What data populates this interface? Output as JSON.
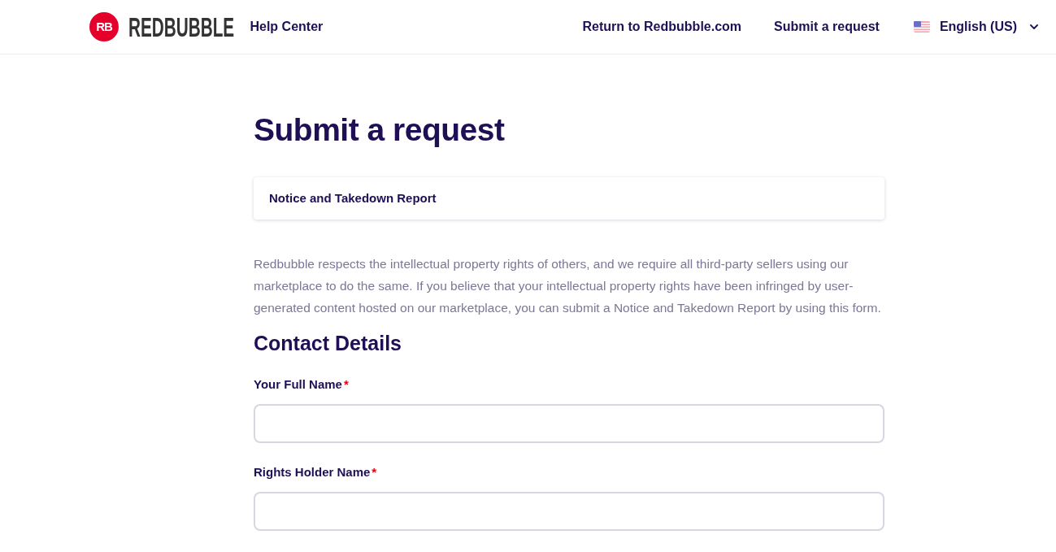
{
  "header": {
    "logo": {
      "mark": "RB",
      "wordmark": "REDBUBBLE"
    },
    "site_title": "Help Center",
    "nav_links": [
      "Return to Redbubble.com",
      "Submit a request"
    ],
    "language": {
      "label": "English (US)"
    }
  },
  "page": {
    "title": "Submit a request",
    "form_selector": {
      "value": "Notice and Takedown Report"
    },
    "description": "Redbubble respects the intellectual property rights of others, and we require all third-party sellers using our marketplace to do the same. If you believe that your intellectual property rights have been infringed by user-generated content hosted on our marketplace, you can submit a Notice and Takedown Report by using this form.",
    "section_title": "Contact Details",
    "fields": [
      {
        "label": "Your Full Name",
        "required_mark": "*"
      },
      {
        "label": "Rights Holder Name",
        "required_mark": "*"
      }
    ]
  }
}
